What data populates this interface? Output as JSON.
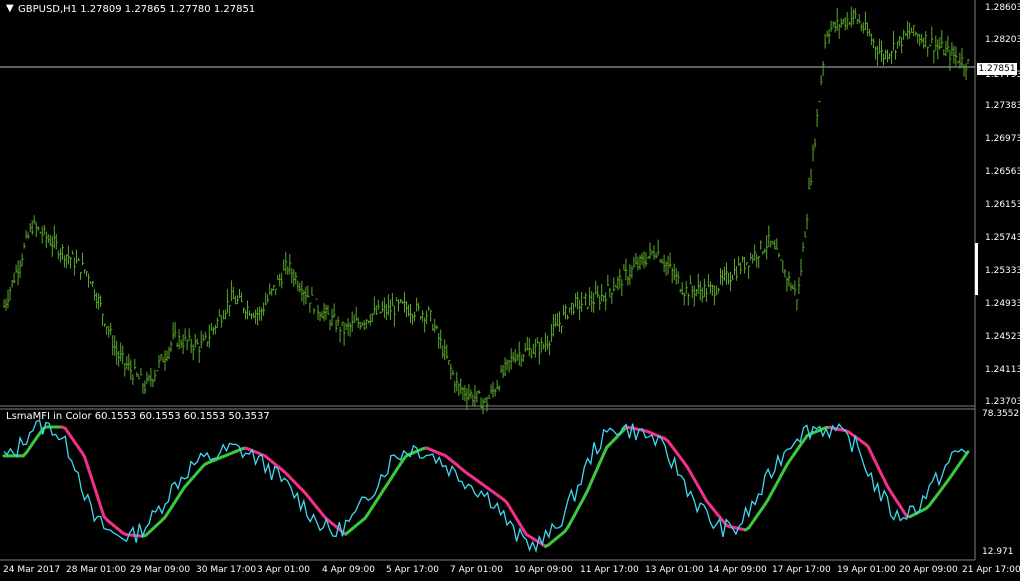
{
  "main_pane": {
    "title": "GBPUSD,H1  1.27809 1.27865 1.27780 1.27851",
    "current_price": "1.27851",
    "price_scale": [
      "1.28603",
      "1.28203",
      "1.27793",
      "1.27383",
      "1.26973",
      "1.26563",
      "1.26153",
      "1.25743",
      "1.25333",
      "1.24933",
      "1.24523",
      "1.24113",
      "1.23703"
    ]
  },
  "indicator_pane": {
    "title": "LsmaMFI in Color 60.1553 60.1553 60.1553 50.3537",
    "scale_top": "78.3552",
    "scale_bottom": "12.971"
  },
  "time_axis": [
    "24 Mar 2017",
    "28 Mar 01:00",
    "29 Mar 09:00",
    "30 Mar 17:00",
    "3 Apr 01:00",
    "4 Apr 09:00",
    "5 Apr 17:00",
    "7 Apr 01:00",
    "10 Apr 09:00",
    "11 Apr 17:00",
    "13 Apr 01:00",
    "14 Apr 09:00",
    "17 Apr 17:00",
    "19 Apr 01:00",
    "20 Apr 09:00",
    "21 Apr 17:00"
  ],
  "colors": {
    "background": "#000000",
    "price_bars": "#5aa82a",
    "mfi_line": "#3fd8f0",
    "lsma_up": "#3cc83c",
    "lsma_down": "#f0308a",
    "grid_line": "#808080"
  },
  "chart_data": {
    "type": "line",
    "price_series": {
      "name": "GBPUSD,H1",
      "approx_close": [
        1.249,
        1.259,
        1.256,
        1.253,
        1.243,
        1.239,
        1.245,
        1.244,
        1.25,
        1.248,
        1.254,
        1.249,
        1.246,
        1.248,
        1.249,
        1.248,
        1.239,
        1.237,
        1.243,
        1.244,
        1.249,
        1.25,
        1.253,
        1.256,
        1.251,
        1.251,
        1.254,
        1.257,
        1.25,
        1.283,
        1.285,
        1.28,
        1.283,
        1.281,
        1.279
      ],
      "ylim": [
        1.23703,
        1.28603
      ]
    },
    "indicator_series": {
      "name": "LsmaMFI in Color",
      "values_shown": [
        60.1553,
        60.1553,
        60.1553,
        50.3537
      ],
      "ylim": [
        12.971,
        78.3552
      ]
    }
  }
}
